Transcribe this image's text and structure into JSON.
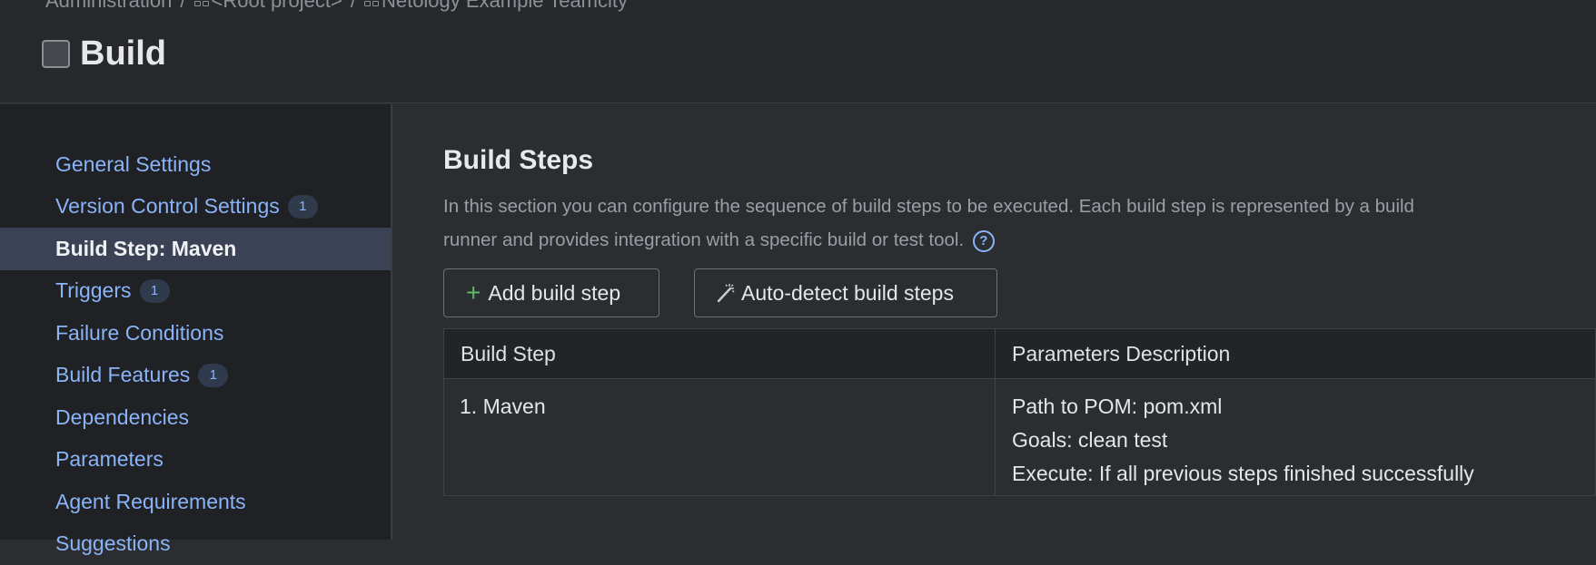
{
  "breadcrumb": {
    "items": [
      "Administration",
      "<Root project>",
      "Netology Example Teamcity"
    ],
    "separator": "/"
  },
  "page": {
    "title": "Build"
  },
  "sidebar": {
    "items": [
      {
        "label": "General Settings",
        "badge": ""
      },
      {
        "label": "Version Control Settings",
        "badge": "1"
      },
      {
        "label": "Build Step: Maven",
        "badge": "",
        "active": true
      },
      {
        "label": "Triggers",
        "badge": "1"
      },
      {
        "label": "Failure Conditions",
        "badge": ""
      },
      {
        "label": "Build Features",
        "badge": "1"
      },
      {
        "label": "Dependencies",
        "badge": ""
      },
      {
        "label": "Parameters",
        "badge": ""
      },
      {
        "label": "Agent Requirements",
        "badge": ""
      },
      {
        "label": "Suggestions",
        "badge": ""
      }
    ]
  },
  "main": {
    "section_title": "Build Steps",
    "description": "In this section you can configure the sequence of build steps to be executed. Each build step is represented by a build runner and provides integration with a specific build or test tool.",
    "help_icon": "?",
    "buttons": {
      "add_label": "Add build step",
      "add_icon": "+",
      "autodetect_label": "Auto-detect build steps"
    },
    "table": {
      "headers": [
        "Build Step",
        "Parameters Description"
      ],
      "rows": [
        {
          "step": "1. Maven",
          "params": [
            "Path to POM: pom.xml",
            "Goals: clean test",
            "Execute: If all previous steps finished successfully"
          ]
        }
      ]
    }
  },
  "colors": {
    "link": "#8ab4f8",
    "active_nav_bg": "#3b4256",
    "add_icon": "#5fb865"
  }
}
